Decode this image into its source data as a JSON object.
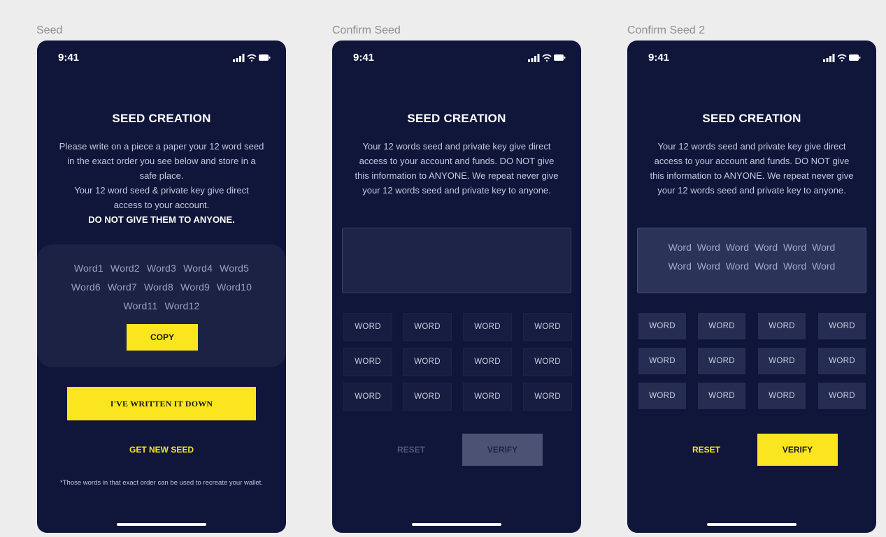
{
  "frames": [
    {
      "label": "Seed",
      "time": "9:41",
      "title": "SEED CREATION",
      "desc_lines": [
        "Please write on a piece a paper your 12 word seed",
        "in the exact order you see below and store in a",
        "safe place.",
        "Your 12 word seed & private key give direct",
        "access to your account.",
        "DO NOT GIVE THEM TO ANYONE."
      ],
      "seed_words": [
        "Word1",
        "Word2",
        "Word3",
        "Word4",
        "Word5",
        "Word6",
        "Word7",
        "Word8",
        "Word9",
        "Word10",
        "Word11",
        "Word12"
      ],
      "copy_label": "COPY",
      "written_label": "I'VE WRITTEN IT DOWN",
      "new_seed_label": "GET NEW SEED",
      "footnote": "*Those words in that exact order can be used to recreate your wallet."
    },
    {
      "label": "Confirm Seed",
      "time": "9:41",
      "title": "SEED CREATION",
      "desc_lines": [
        "Your 12 words seed and private key give direct",
        "access to your account and funds. DO NOT give",
        "this information to ANYONE. We repeat never give",
        "your 12 words seed and private key to anyone."
      ],
      "selected_words": [],
      "word_buttons": [
        "WORD",
        "WORD",
        "WORD",
        "WORD",
        "WORD",
        "WORD",
        "WORD",
        "WORD",
        "WORD",
        "WORD",
        "WORD",
        "WORD"
      ],
      "reset_label": "RESET",
      "verify_label": "VERIFY",
      "buttons_enabled": false
    },
    {
      "label": "Confirm Seed 2",
      "time": "9:41",
      "title": "SEED CREATION",
      "desc_lines": [
        "Your 12 words seed and private key give direct",
        "access to your account and funds. DO NOT give",
        "this information to ANYONE. We repeat never give",
        "your 12 words seed and private key to anyone."
      ],
      "selected_words": [
        "Word",
        "Word",
        "Word",
        "Word",
        "Word",
        "Word",
        "Word",
        "Word",
        "Word",
        "Word",
        "Word",
        "Word"
      ],
      "word_buttons": [
        "WORD",
        "WORD",
        "WORD",
        "WORD",
        "WORD",
        "WORD",
        "WORD",
        "WORD",
        "WORD",
        "WORD",
        "WORD",
        "WORD"
      ],
      "reset_label": "RESET",
      "verify_label": "VERIFY",
      "buttons_enabled": true
    }
  ],
  "colors": {
    "background": "#ededee",
    "phone": "#10163a",
    "accent": "#fbe51e",
    "disabled_button": "#4b5274"
  },
  "icons": [
    "signal-icon",
    "wifi-icon",
    "battery-icon"
  ]
}
